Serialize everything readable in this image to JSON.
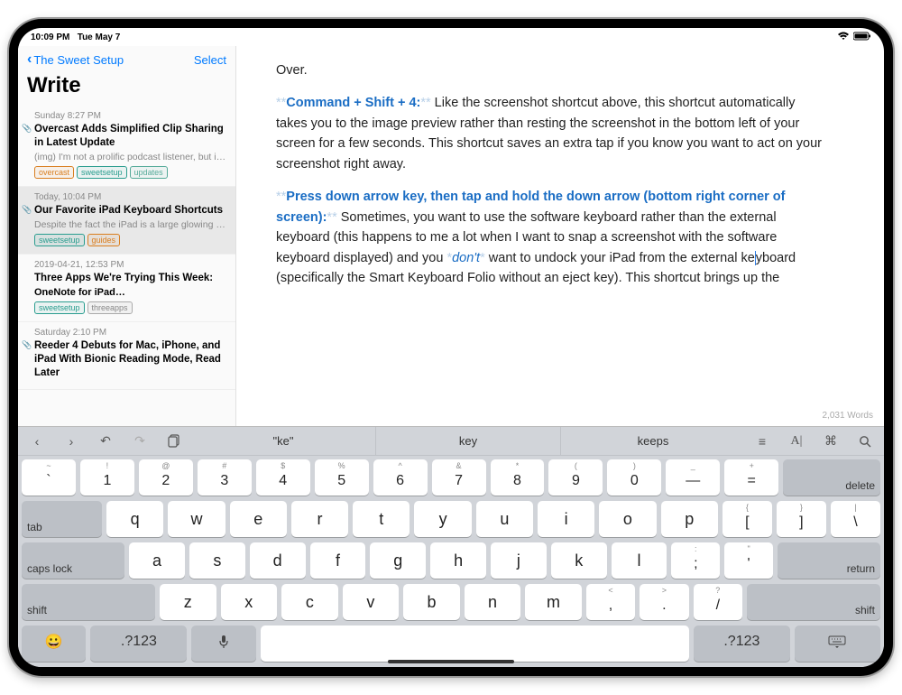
{
  "status": {
    "time": "10:09 PM",
    "date": "Tue May 7"
  },
  "sidebar": {
    "back_label": "The Sweet Setup",
    "select_label": "Select",
    "title": "Write",
    "notes": [
      {
        "date": "Sunday 8:27 PM",
        "title": "Overcast Adds Simplified Clip Sharing in Latest Update",
        "preview": "(img) I'm not a prolific podcast listener, but it…",
        "tags": [
          {
            "text": "overcast",
            "cls": "tag-orange"
          },
          {
            "text": "sweetsetup",
            "cls": "tag-teal"
          },
          {
            "text": "updates",
            "cls": "tag-green"
          }
        ],
        "clip": true
      },
      {
        "date": "Today, 10:04 PM",
        "title": "Our Favorite iPad Keyboard Shortcuts",
        "preview": "Despite the fact the iPad is a large glowing touchscreen, it almost feels like it was built to…",
        "tags": [
          {
            "text": "sweetsetup",
            "cls": "tag-teal"
          },
          {
            "text": "guides",
            "cls": "tag-orange"
          }
        ],
        "clip": true,
        "selected": true
      },
      {
        "date": "2019-04-21, 12:53 PM",
        "title": "Three Apps We're Trying This Week:",
        "sub": "OneNote for iPad…",
        "tags": [
          {
            "text": "sweetsetup",
            "cls": "tag-teal"
          },
          {
            "text": "threeapps",
            "cls": "tag-gray"
          }
        ]
      },
      {
        "date": "Saturday 2:10 PM",
        "title": "Reeder 4 Debuts for Mac, iPhone, and iPad With Bionic Reading Mode, Read Later",
        "clip": true
      }
    ]
  },
  "editor": {
    "p0": "Over.",
    "s1_bold": "Command + Shift + 4:",
    "s1_rest": " Like the screenshot shortcut above, this shortcut automatically takes you to the image preview rather than resting the screenshot in the bottom left of your screen for a few seconds. This shortcut saves an extra tap if you know you want to act on your screenshot right away.",
    "s2_bold": "Press down arrow key, then tap and hold the down arrow (bottom right corner of screen):",
    "s2_rest_a": " Sometimes, you want to use the software keyboard rather than the external keyboard (this happens to me a lot when I want to snap a screenshot with the software keyboard displayed) and you ",
    "s2_italic": "don't",
    "s2_rest_b": " want to undock your iPad from the external ke",
    "s2_rest_c": "yboard (specifically the Smart Keyboard Folio without an eject key). This shortcut brings up the",
    "wordcount": "2,031 Words"
  },
  "keyboard": {
    "suggestions": [
      "\"ke\"",
      "key",
      "keeps"
    ]
  }
}
